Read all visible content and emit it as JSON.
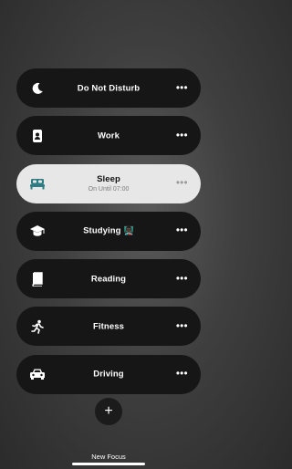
{
  "focus_modes": [
    {
      "label": "Do Not Disturb",
      "icon": "moon-icon",
      "active": false
    },
    {
      "label": "Work",
      "icon": "id-badge-icon",
      "active": false
    },
    {
      "label": "Sleep",
      "sublabel": "On Until 07:00",
      "icon": "bed-icon",
      "active": true
    },
    {
      "label": "Studying",
      "emoji": "👨🏿‍🏫",
      "icon": "graduation-cap-icon",
      "active": false
    },
    {
      "label": "Reading",
      "icon": "book-icon",
      "active": false
    },
    {
      "label": "Fitness",
      "icon": "running-icon",
      "active": false
    },
    {
      "label": "Driving",
      "icon": "car-icon",
      "active": false
    }
  ],
  "more_glyph": "•••",
  "new_focus": {
    "glyph": "+",
    "label": "New Focus"
  },
  "colors": {
    "active_icon": "#2e7d83",
    "pill_bg": "#161616",
    "active_pill_bg": "#e7e7e7"
  }
}
